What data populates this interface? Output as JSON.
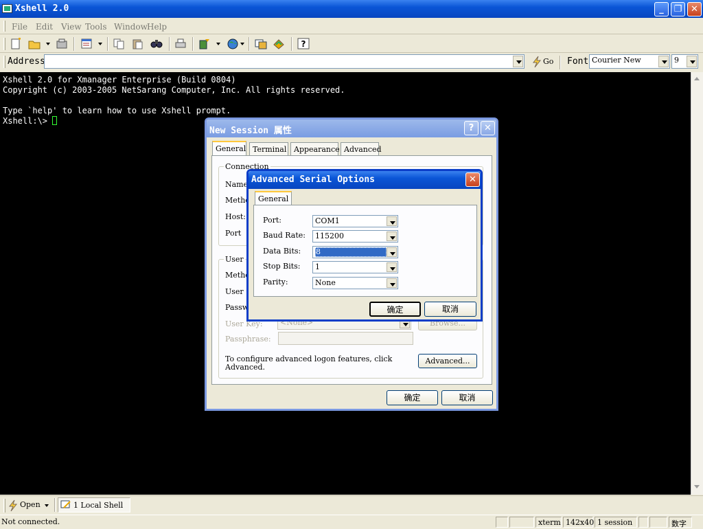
{
  "window": {
    "title": "Xshell 2.0"
  },
  "menu": [
    "File",
    "Edit",
    "View",
    "Tools",
    "Window",
    "Help"
  ],
  "address_bar": {
    "label": "Address",
    "value": "",
    "go_label": "Go",
    "font_label": "Font",
    "font_value": "Courier New",
    "size_value": "9"
  },
  "terminal": {
    "lines": [
      "Xshell 2.0 for Xmanager Enterprise (Build 0804)",
      "Copyright (c) 2003-2005 NetSarang Computer, Inc. All rights reserved.",
      "",
      "Type `help' to learn how to use Xshell prompt."
    ],
    "prompt": "Xshell:\\> "
  },
  "session_dialog": {
    "title": "New Session 属性",
    "tabs": [
      "General",
      "Terminal",
      "Appearance",
      "Advanced"
    ],
    "connection_group": "Connection",
    "fields": [
      "Name:",
      "Metho",
      "Host:",
      "Port"
    ],
    "user_group": "User",
    "user_fields": [
      "Metho",
      "User",
      "Passw"
    ],
    "user_key_label": "User Key:",
    "user_key_value": "<None>",
    "browse_label": "Browse...",
    "passphrase_label": "Passphrase:",
    "advanced_note": "To configure advanced logon features, click Advanced.",
    "advanced_button": "Advanced...",
    "ok": "确定",
    "cancel": "取消"
  },
  "serial_dialog": {
    "title": "Advanced Serial Options",
    "tab": "General",
    "fields": [
      {
        "label": "Port:",
        "value": "COM1"
      },
      {
        "label": "Baud Rate:",
        "value": "115200"
      },
      {
        "label": "Data Bits:",
        "value": "8"
      },
      {
        "label": "Stop Bits:",
        "value": "1"
      },
      {
        "label": "Parity:",
        "value": "None"
      }
    ],
    "ok": "确定",
    "cancel": "取消"
  },
  "bottom": {
    "open_label": "Open",
    "session_tab": "1 Local Shell"
  },
  "status": {
    "left": "Not connected.",
    "term": "xterm",
    "size": "142x40",
    "sessions": "1 session",
    "mode": "数字"
  }
}
